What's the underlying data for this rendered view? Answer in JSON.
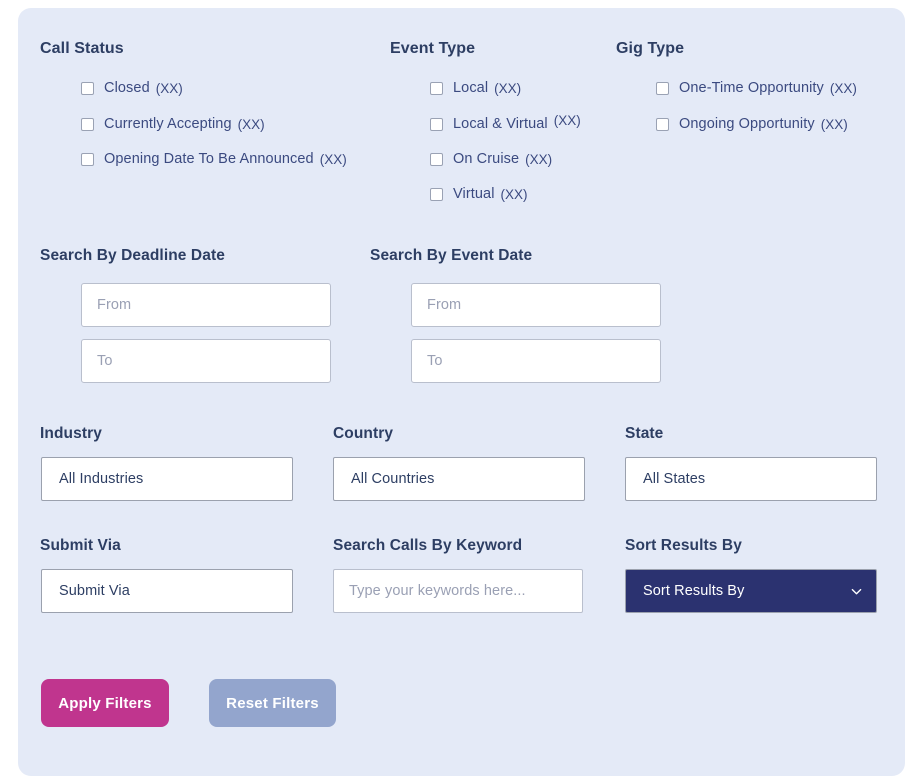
{
  "panel": {
    "background_color": "#e4eaf7"
  },
  "call_status": {
    "title": "Call Status",
    "options": [
      {
        "label": "Closed",
        "count": "(XX)"
      },
      {
        "label": "Currently Accepting",
        "count": "(XX)"
      },
      {
        "label": "Opening Date To Be Announced",
        "count": "(XX)"
      }
    ]
  },
  "event_type": {
    "title": "Event Type",
    "options": [
      {
        "label": "Local",
        "count": "(XX)"
      },
      {
        "label": "Local & Virtual",
        "count": "(XX)"
      },
      {
        "label": "On Cruise",
        "count": "(XX)"
      },
      {
        "label": "Virtual",
        "count": "(XX)"
      }
    ]
  },
  "gig_type": {
    "title": "Gig Type",
    "options": [
      {
        "label": "One-Time Opportunity",
        "count": "(XX)"
      },
      {
        "label": "Ongoing Opportunity",
        "count": "(XX)"
      }
    ]
  },
  "deadline_date": {
    "title": "Search By Deadline Date",
    "from_placeholder": "From",
    "to_placeholder": "To",
    "from_value": "",
    "to_value": ""
  },
  "event_date": {
    "title": "Search By Event Date",
    "from_placeholder": "From",
    "to_placeholder": "To",
    "from_value": "",
    "to_value": ""
  },
  "industry": {
    "label": "Industry",
    "value": "All Industries"
  },
  "country": {
    "label": "Country",
    "value": "All Countries"
  },
  "state": {
    "label": "State",
    "value": "All States"
  },
  "submit_via": {
    "label": "Submit Via",
    "value": "Submit Via"
  },
  "keyword": {
    "label": "Search Calls By Keyword",
    "placeholder": "Type your keywords here...",
    "value": ""
  },
  "sort_results": {
    "label": "Sort Results By",
    "value": "Sort Results By",
    "icon": "chevron-down-icon",
    "background_color": "#2b3270",
    "text_color": "#ffffff"
  },
  "actions": {
    "apply_label": "Apply Filters",
    "apply_color": "#c0358e",
    "reset_label": "Reset Filters",
    "reset_color": "#93a5cd"
  }
}
